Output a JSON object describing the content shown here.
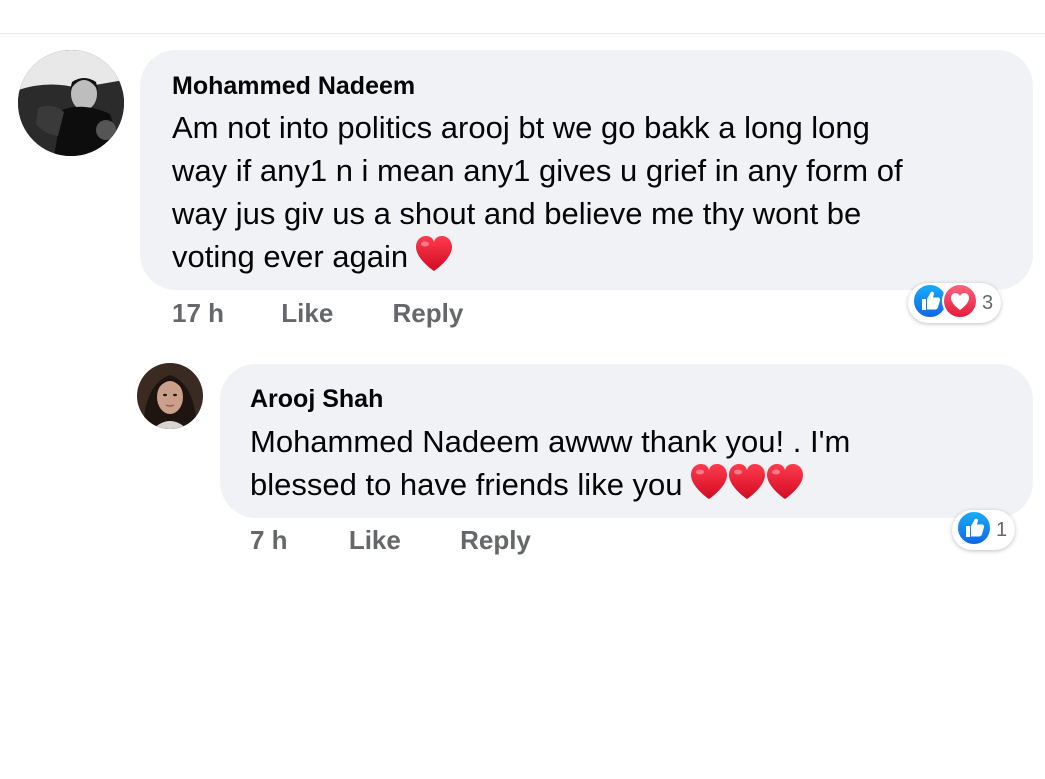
{
  "comments": [
    {
      "author": "Mohammed Nadeem",
      "lines": [
        "Am not into politics arooj bt we go bakk a long long",
        "way if any1 n i mean any1 gives u grief in any form of",
        "way jus giv us a shout and believe me thy wont be",
        "voting ever again"
      ],
      "emoji": [
        "red-heart"
      ],
      "time": "17 h",
      "like_label": "Like",
      "reply_label": "Reply",
      "reactions": [
        "like",
        "love"
      ],
      "reaction_count": "3"
    },
    {
      "author": "Arooj Shah",
      "lines": [
        "Mohammed Nadeem awww thank you! . I'm",
        "blessed to have friends like you"
      ],
      "emoji": [
        "red-heart",
        "red-heart",
        "red-heart"
      ],
      "time": "7 h",
      "like_label": "Like",
      "reply_label": "Reply",
      "reactions": [
        "like"
      ],
      "reaction_count": "1"
    }
  ],
  "colors": {
    "bubble": "#f0f2f5",
    "secondary_text": "#65676b",
    "like_blue": "#1877f2",
    "love_red": "#f33e58",
    "heart_red": "#e0102a"
  }
}
